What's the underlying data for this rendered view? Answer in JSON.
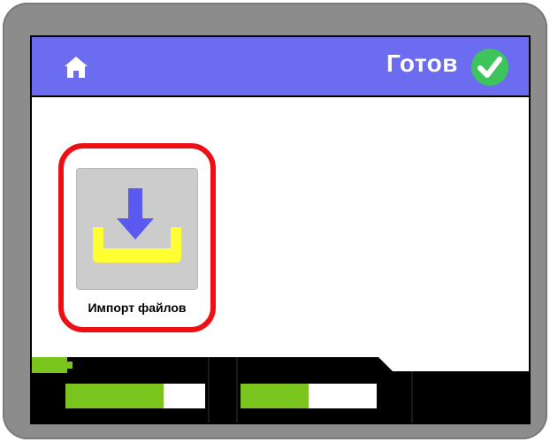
{
  "header": {
    "home_icon": "home-icon",
    "status_text": "Готов",
    "status_icon": "check-circle-icon",
    "colors": {
      "header_bg": "#6c6cf0",
      "status_check": "#3dc45a"
    }
  },
  "main": {
    "tiles": [
      {
        "label": "Импорт файлов",
        "icon": "import-download-tray-icon",
        "selected": true,
        "colors": {
          "highlight": "#ee0f14",
          "arrow": "#5a5af0",
          "tray": "#ffff33"
        }
      }
    ]
  },
  "footer": {
    "progress_bars": [
      {
        "name": "bar-1",
        "fill": 0.7
      },
      {
        "name": "bar-2",
        "fill": 0.5
      }
    ],
    "battery_icon": "battery-icon",
    "colors": {
      "bar_fill": "#7ac51d",
      "battery": "#7ac51d"
    }
  }
}
